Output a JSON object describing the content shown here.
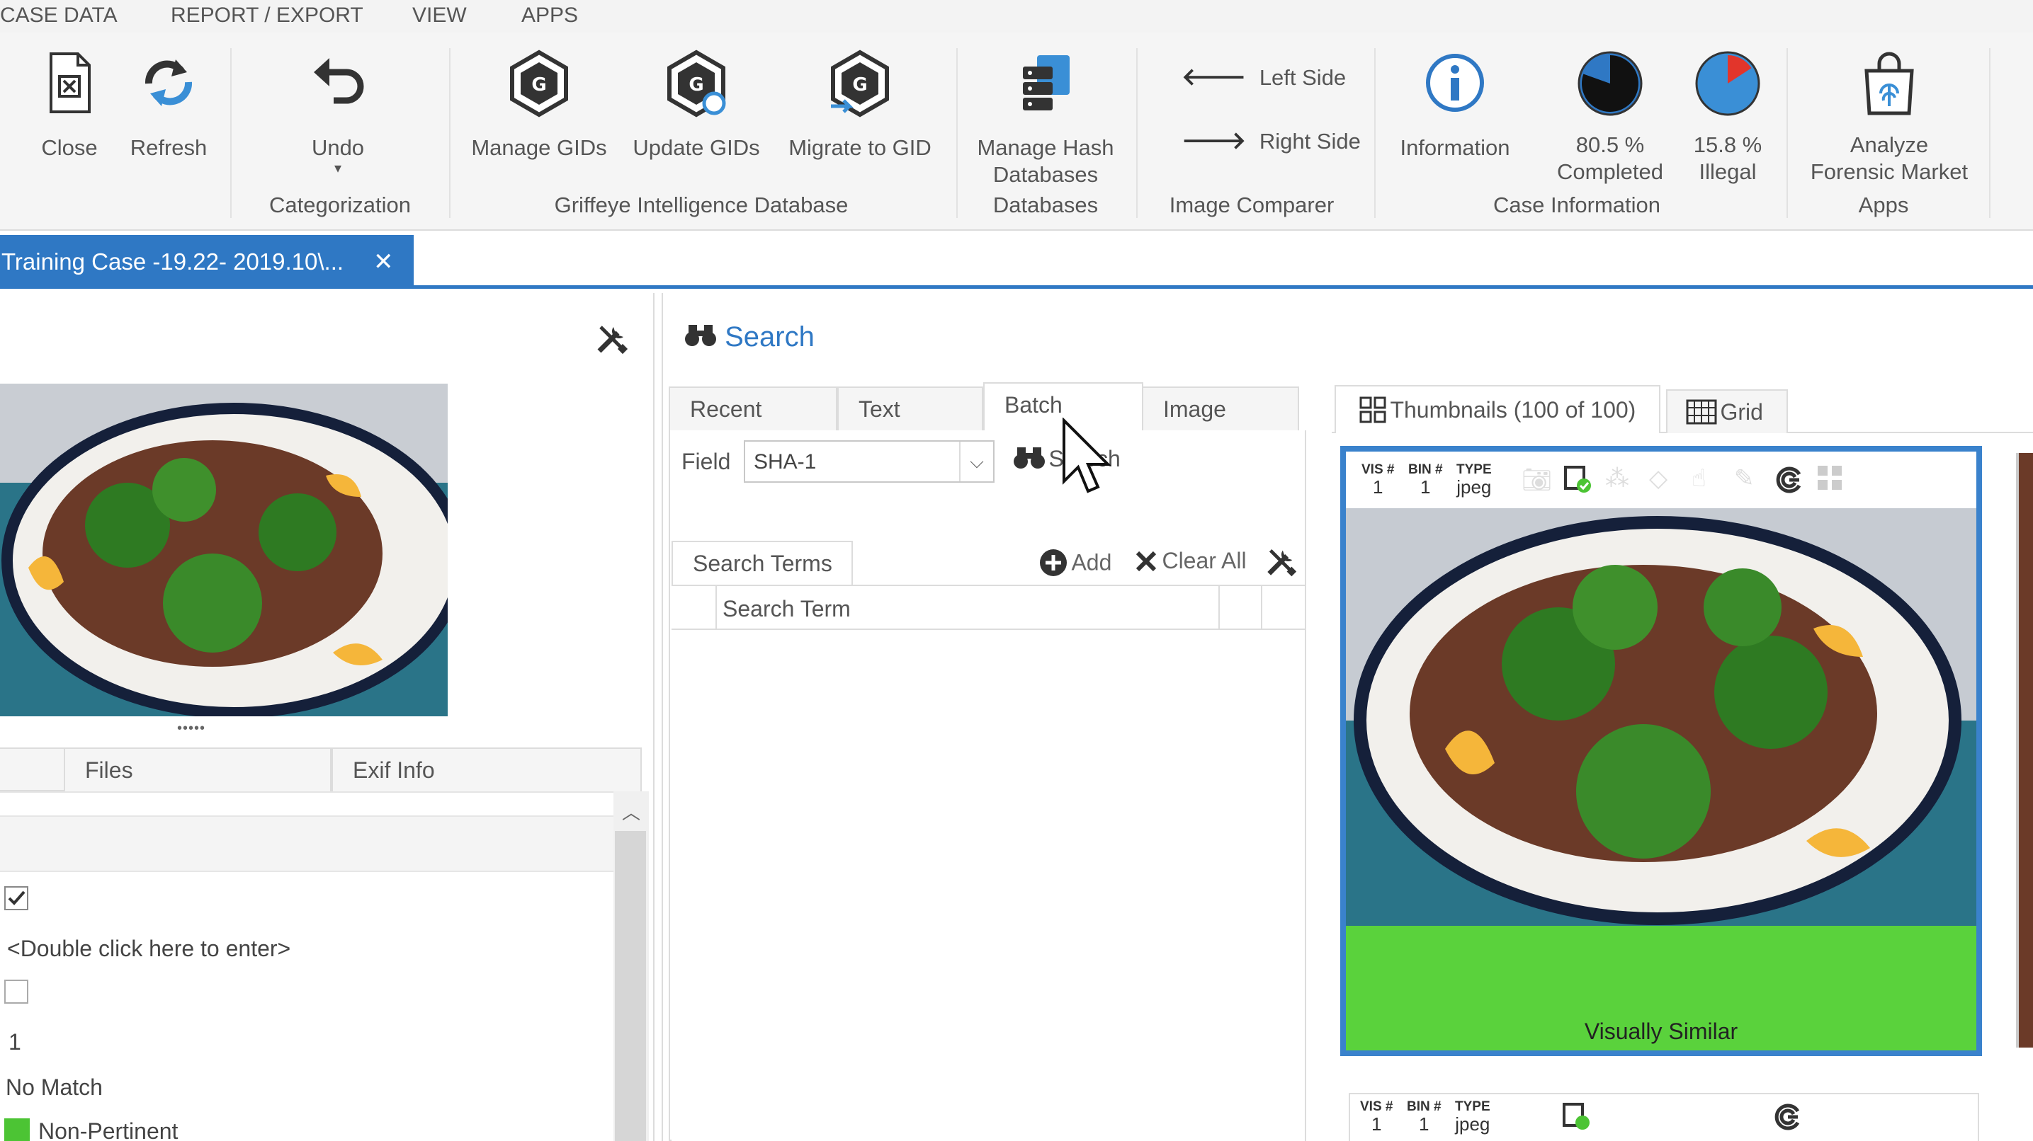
{
  "menu": {
    "items": [
      "CASE DATA",
      "REPORT / EXPORT",
      "VIEW",
      "APPS"
    ]
  },
  "ribbon": {
    "buttons": {
      "close": "Close",
      "refresh": "Refresh",
      "undo": "Undo",
      "manage_gids": "Manage GIDs",
      "update_gids": "Update GIDs",
      "migrate_gid": "Migrate to GID",
      "manage_hash_1": "Manage Hash",
      "manage_hash_2": "Databases",
      "left_side": "Left Side",
      "right_side": "Right Side",
      "information": "Information",
      "completed_pct": "80.5 %",
      "completed_label": "Completed",
      "illegal_pct": "15.8 %",
      "illegal_label": "Illegal",
      "analyze_1": "Analyze",
      "analyze_2": "Forensic Market"
    },
    "groups": {
      "categorization": "Categorization",
      "gid": "Griffeye Intelligence Database",
      "databases": "Databases",
      "image_comparer": "Image Comparer",
      "case_info": "Case Information",
      "apps": "Apps"
    },
    "progress": {
      "completed": 0.805,
      "illegal": 0.158
    }
  },
  "doc_tab": {
    "title": "Training Case -19.22- 2019.10\\...",
    "close": "✕"
  },
  "left_panel": {
    "tabs": [
      "Files",
      "Exif Info"
    ],
    "grip": "•••••",
    "rows": {
      "double_click": "<Double click here to enter>",
      "number": "1",
      "match": "No Match",
      "category": "Non-Pertinent"
    },
    "category_color": "#4cc434"
  },
  "search": {
    "title": "Search",
    "tabs": [
      "Recent",
      "Text",
      "Batch",
      "Image"
    ],
    "active_tab": "Batch",
    "field_label": "Field",
    "field_value": "SHA-1",
    "search_button": "Search",
    "subtab": "Search Terms",
    "add": "Add",
    "clear_all": "Clear All",
    "column": "Search Term"
  },
  "thumbnails": {
    "tab": "Thumbnails (100 of 100)",
    "grid_tab": "Grid",
    "card": {
      "vis_label": "VIS #",
      "vis_value": "1",
      "bin_label": "BIN #",
      "bin_value": "1",
      "type_label": "TYPE",
      "type_value": "jpeg",
      "caption": "Visually Similar"
    },
    "caption_color": "#5ad23c",
    "accent": "#3a82cc"
  }
}
